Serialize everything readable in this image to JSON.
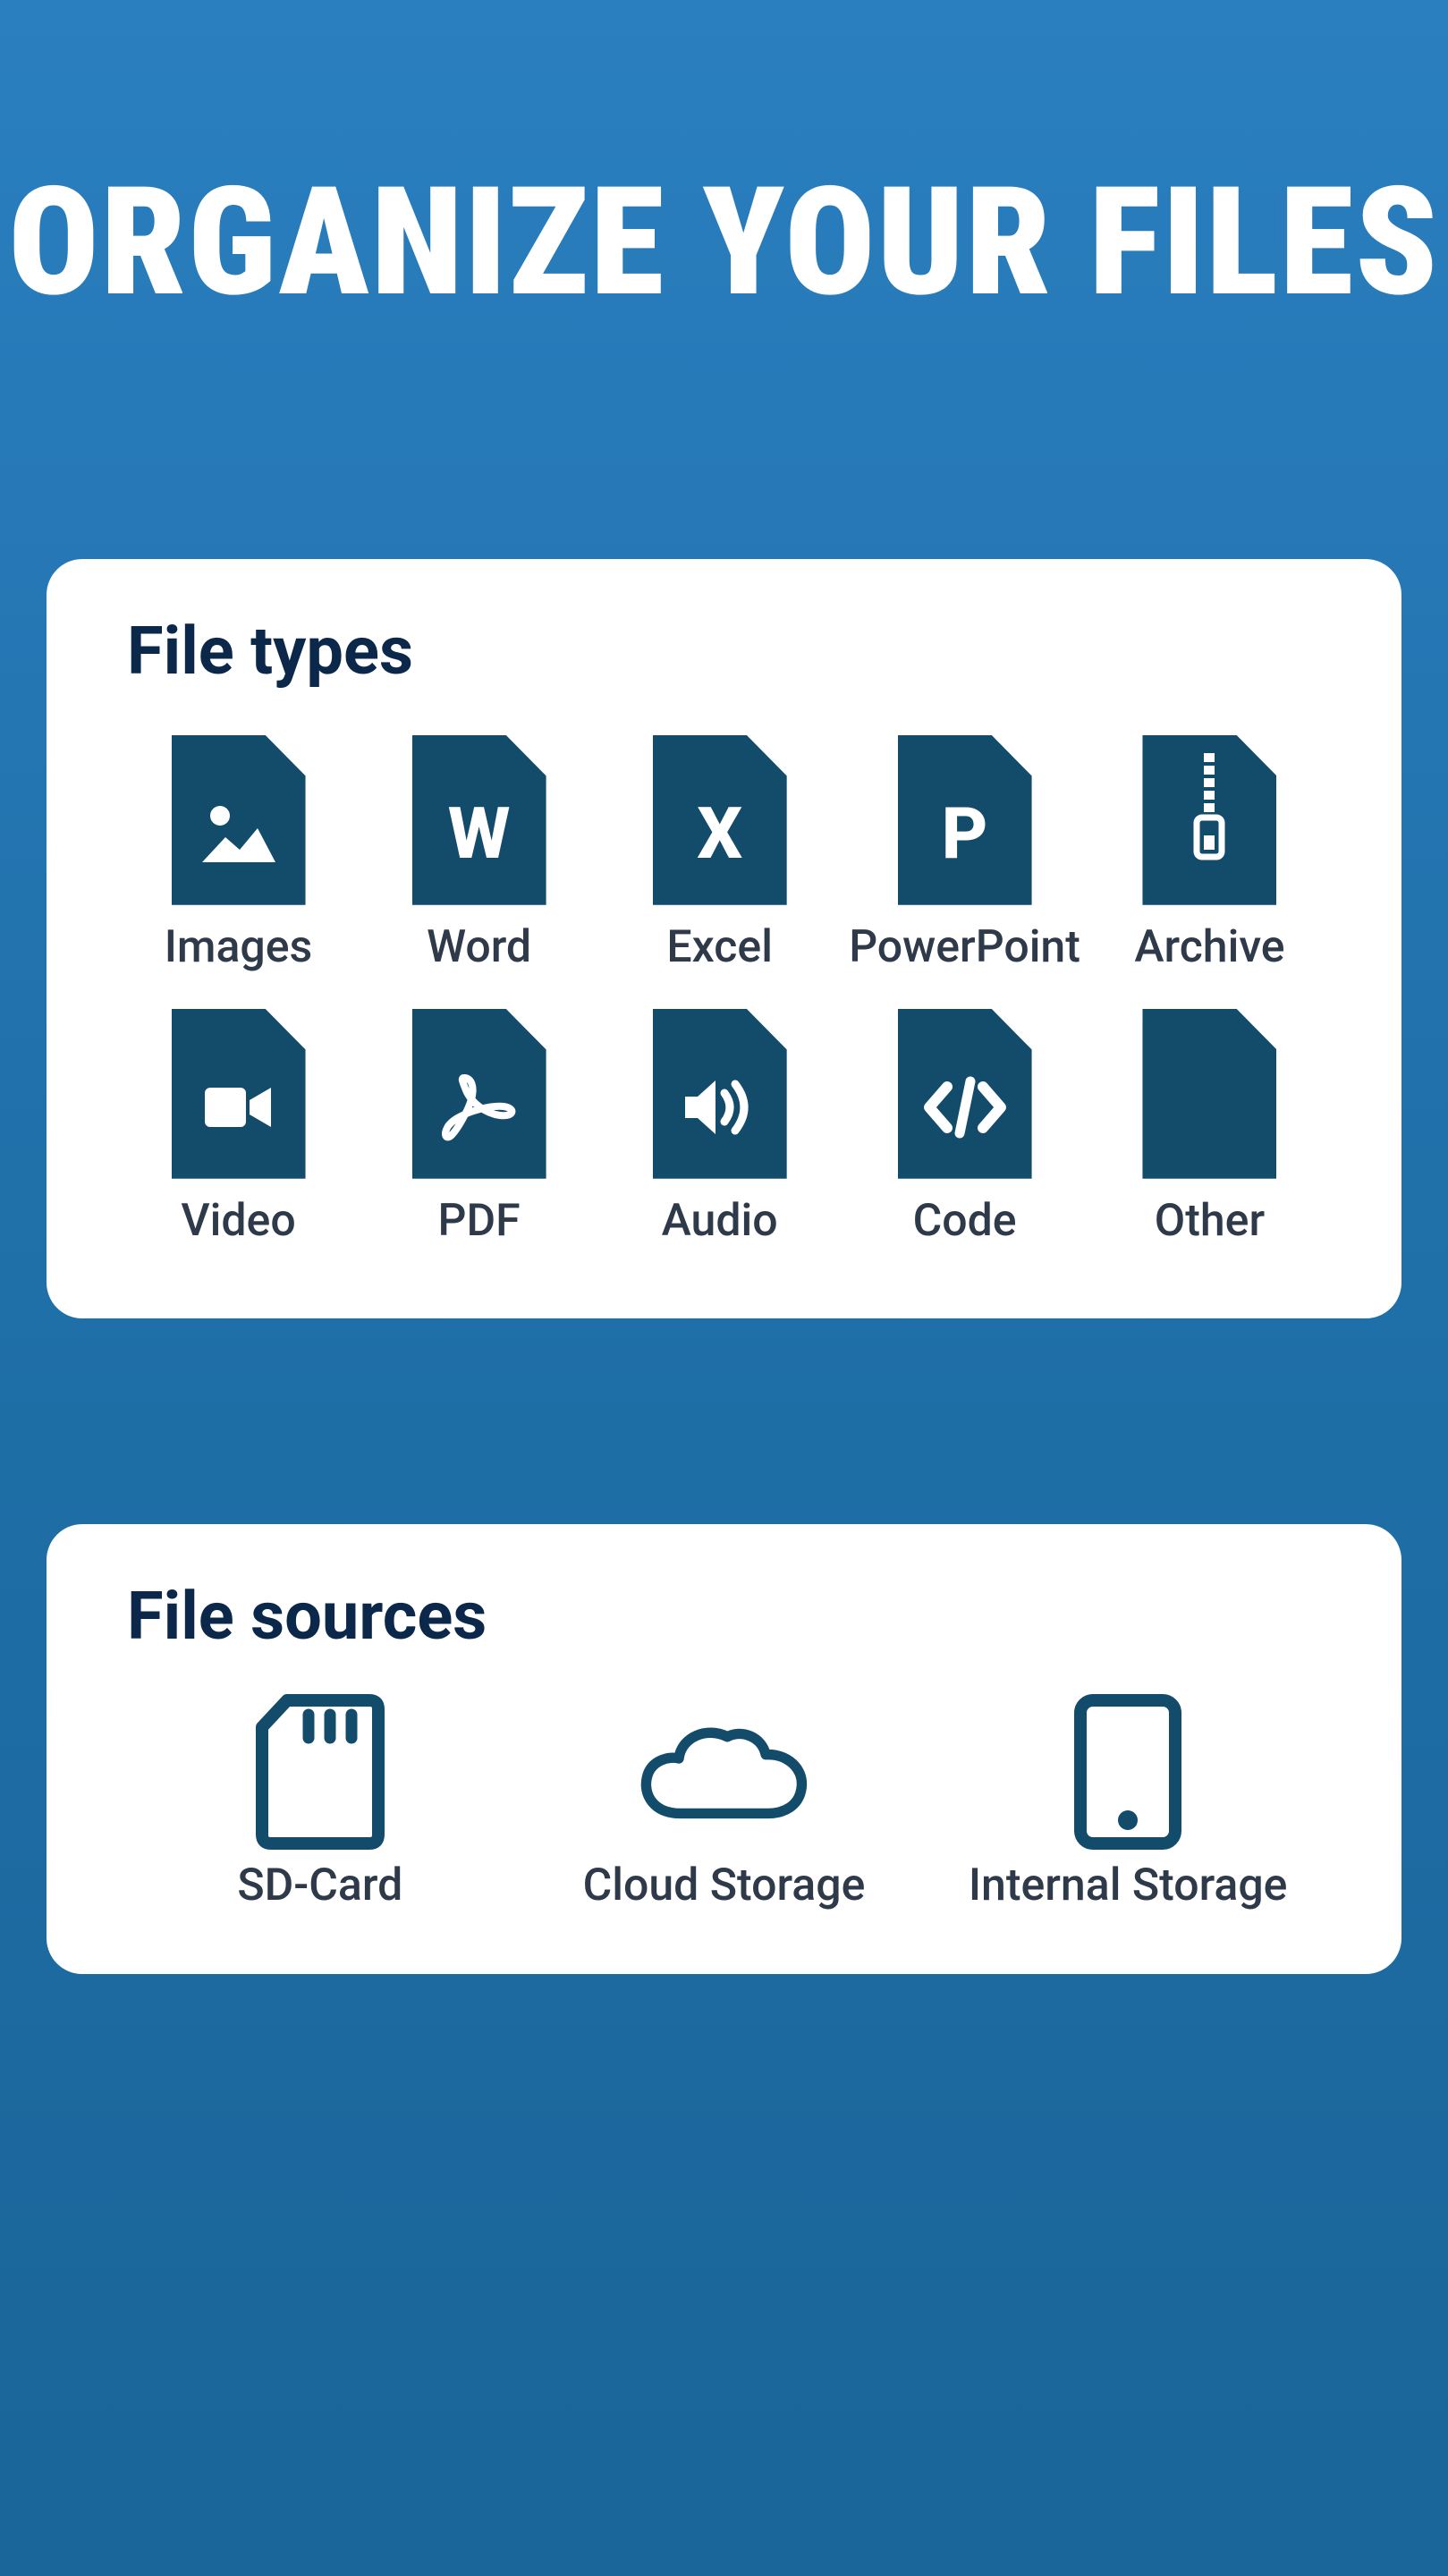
{
  "title": "ORGANIZE YOUR FILES",
  "sections": {
    "types": {
      "title": "File types",
      "items": [
        {
          "label": "Images"
        },
        {
          "label": "Word"
        },
        {
          "label": "Excel"
        },
        {
          "label": "PowerPoint"
        },
        {
          "label": "Archive"
        },
        {
          "label": "Video"
        },
        {
          "label": "PDF"
        },
        {
          "label": "Audio"
        },
        {
          "label": "Code"
        },
        {
          "label": "Other"
        }
      ]
    },
    "sources": {
      "title": "File sources",
      "items": [
        {
          "label": "SD-Card"
        },
        {
          "label": "Cloud Storage"
        },
        {
          "label": "Internal Storage"
        }
      ]
    }
  },
  "colors": {
    "iconFill": "#134c6b",
    "iconStroke": "#134c6b"
  }
}
